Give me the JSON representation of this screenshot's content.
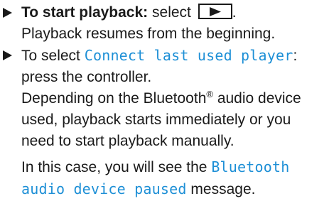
{
  "step1": {
    "bold_label": "To start playback:",
    "text_select": "select",
    "key_icon": "play-icon",
    "period": ".",
    "result": "Playback resumes from the beginning."
  },
  "step2": {
    "text_prefix": "To select",
    "menu_item": "Connect last used player",
    "text_suffix": ":",
    "line2": "press the controller.",
    "note_part1": "Depending on the Bluetooth",
    "registered": "®",
    "note_part2": " audio device",
    "note_line2": "used, playback starts immediately or you",
    "note_line3": "need to start playback manually.",
    "case_prefix": "In this case, you will see the",
    "message_line1": "Bluetooth",
    "message_line2": "audio device paused",
    "case_suffix": " message."
  },
  "colors": {
    "text": "#1a1a1a",
    "highlight": "#1d8fd6"
  }
}
